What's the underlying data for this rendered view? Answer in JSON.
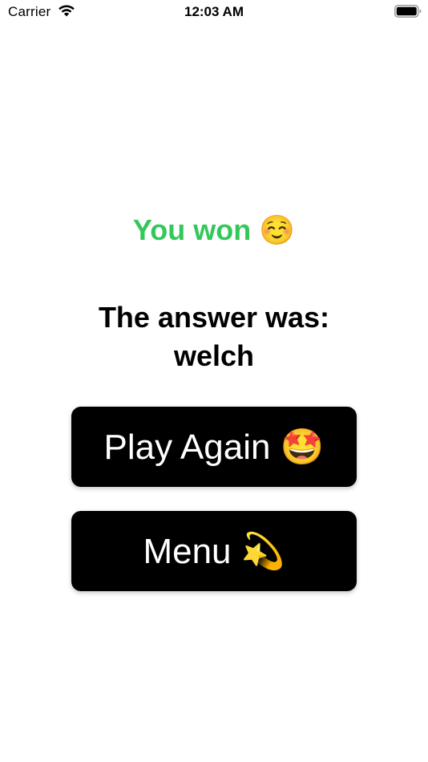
{
  "status_bar": {
    "carrier": "Carrier",
    "time": "12:03 AM"
  },
  "result": {
    "text": "You won ☺️",
    "color": "#34c759"
  },
  "answer": {
    "label": "The answer was:",
    "word": "welch"
  },
  "buttons": {
    "play_again_label": "Play Again 🤩",
    "menu_label": "Menu 💫"
  },
  "colors": {
    "button_background": "#000000",
    "button_text": "#ffffff"
  }
}
